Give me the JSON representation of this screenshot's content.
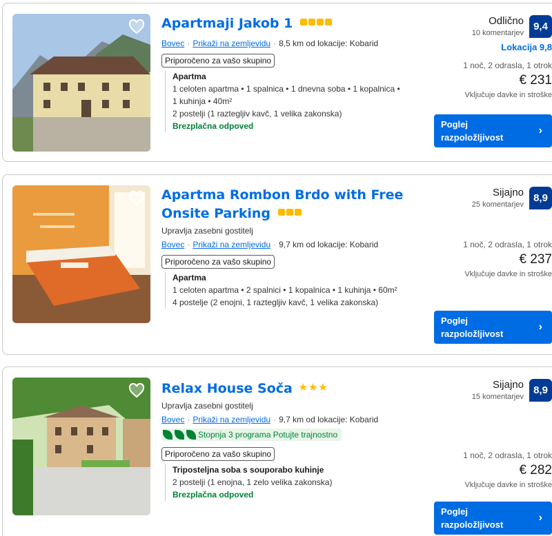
{
  "listings": [
    {
      "title": "Apartmaji Jakob 1",
      "stars": 4,
      "star_style": "squares",
      "managed_by": "",
      "city": "Bovec",
      "map_link": "Prikaži na zemljevidu",
      "distance": "8,5 km od lokacije: Kobarid",
      "sustainability": "",
      "recommended": "Priporočeno za vašo skupino",
      "room_type": "Apartma",
      "room_lines": [
        "1 celoten apartma • 1 spalnica • 1 dnevna soba • 1 kopalnica •",
        "1 kuhinja • 40m²",
        "2 postelji (1 raztegljiv kavč, 1 velika zakonska)"
      ],
      "free_cancel": "Brezplačna odpoved",
      "score_word": "Odlično",
      "reviews": "10 komentarjev",
      "score": "9,4",
      "location_score": "Lokacija 9,8",
      "stay_info": "1 noč, 2 odrasla, 1 otrok",
      "price": "€ 231",
      "tax": "Vključuje davke in stroške",
      "cta": "Poglej razpoložljivost"
    },
    {
      "title": "Apartma Rombon Brdo with Free Onsite Parking",
      "stars": 3,
      "star_style": "squares",
      "managed_by": "Upravlja zasebni gostitelj",
      "city": "Bovec",
      "map_link": "Prikaži na zemljevidu",
      "distance": "9,7 km od lokacije: Kobarid",
      "sustainability": "",
      "recommended": "Priporočeno za vašo skupino",
      "room_type": "Apartma",
      "room_lines": [
        "1 celoten apartma • 2 spalnici • 1 kopalnica • 1 kuhinja • 60m²",
        "4 postelje (2 enojni, 1 raztegljiv kavč, 1 velika zakonska)"
      ],
      "free_cancel": "",
      "score_word": "Sijajno",
      "reviews": "25 komentarjev",
      "score": "8,9",
      "location_score": "",
      "stay_info": "1 noč, 2 odrasla, 1 otrok",
      "price": "€ 237",
      "tax": "Vključuje davke in stroške",
      "cta": "Poglej razpoložljivost"
    },
    {
      "title": "Relax House Soča",
      "stars": 3,
      "star_style": "stars",
      "managed_by": "Upravlja zasebni gostitelj",
      "city": "Bovec",
      "map_link": "Prikaži na zemljevidu",
      "distance": "9,7 km od lokacije: Kobarid",
      "sustainability": "Stopnja 3 programa Potujte trajnostno",
      "recommended": "Priporočeno za vašo skupino",
      "room_type": "Triposteljna soba s souporabo kuhinje",
      "room_lines": [
        "2 postelji (1 enojna, 1 zelo velika zakonska)"
      ],
      "free_cancel": "Brezplačna odpoved",
      "score_word": "Sijajno",
      "reviews": "15 komentarjev",
      "score": "8,9",
      "location_score": "",
      "stay_info": "1 noč, 2 odrasla, 1 otrok",
      "price": "€ 282",
      "tax": "Vključuje davke in stroške",
      "cta": "Poglej razpoložljivost"
    }
  ],
  "colors": {
    "link": "#006ce4",
    "badge": "#003b95",
    "star": "#febb02",
    "green": "#008234"
  },
  "icons": {
    "favorite": "heart-outline-icon",
    "cta": "chevron-right-icon",
    "sustainability": "leaf-icon"
  }
}
